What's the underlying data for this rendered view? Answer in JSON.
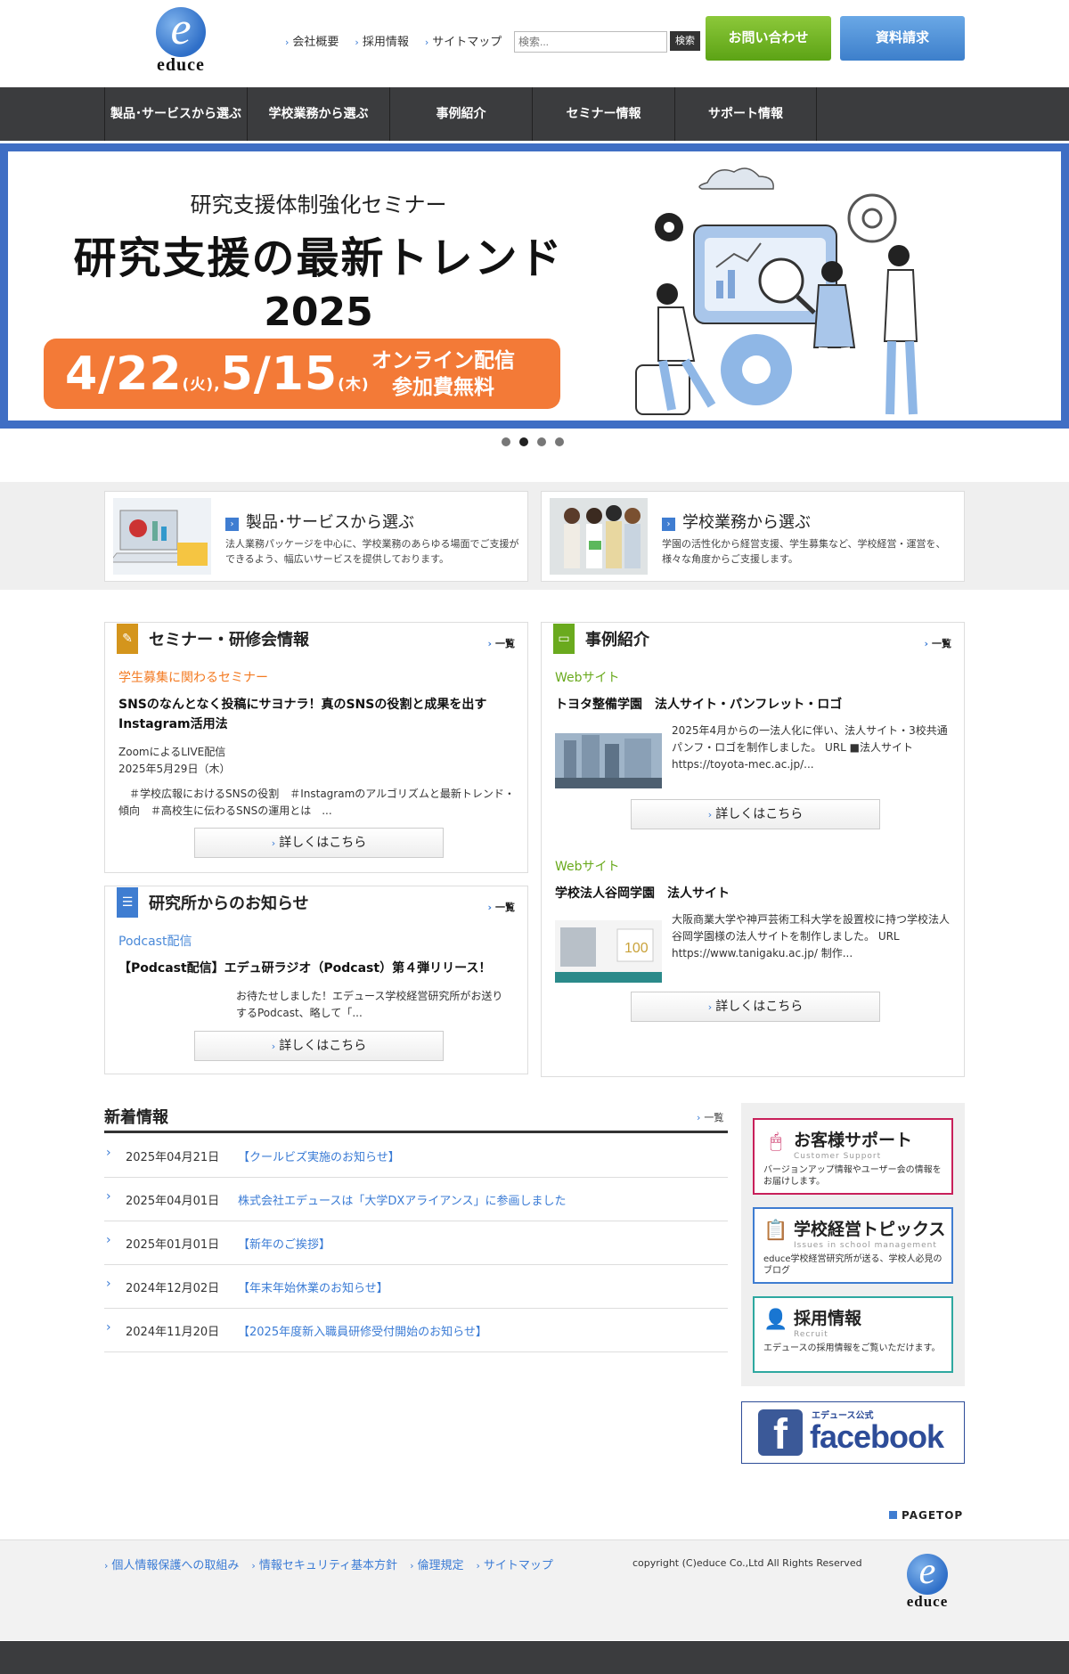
{
  "header": {
    "logo_text": "educe",
    "top_links": [
      "会社概要",
      "採用情報",
      "サイトマップ"
    ],
    "search_placeholder": "検索...",
    "search_button": "検索",
    "contact_button": "お問い合わせ",
    "document_button": "資料請求"
  },
  "nav": {
    "items": [
      "製品･サービスから選ぶ",
      "学校業務から選ぶ",
      "事例紹介",
      "セミナー情報",
      "サポート情報"
    ]
  },
  "hero": {
    "subtitle": "研究支援体制強化セミナー",
    "title": "研究支援の最新トレンド",
    "year": "2025",
    "date1": "4/22",
    "day1": "(火)",
    "date2": "5/15",
    "day2": "(木)",
    "online_line1": "オンライン配信",
    "online_line2": "参加費無料",
    "slide_count": 4,
    "active_slide": 2
  },
  "categories": [
    {
      "title": "製品･サービスから選ぶ",
      "desc": "法人業務パッケージを中心に、学校業務のあらゆる場面でご支援ができるよう、幅広いサービスを提供しております。"
    },
    {
      "title": "学校業務から選ぶ",
      "desc": "学園の活性化から経営支援、学生募集など、学校経営・運営を、様々な角度からご支援します。"
    }
  ],
  "seminar": {
    "title": "セミナー・研修会情報",
    "more": "一覧",
    "tag": "学生募集に関わるセミナー",
    "item_title": "SNSのなんとなく投稿にサヨナラ！真のSNSの役割と成果を出すInstagram活用法",
    "line1": "ZoomによるLIVE配信",
    "line2": "2025年5月29日（木）",
    "desc": "　＃学校広報におけるSNSの役割　＃Instagramのアルゴリズムと最新トレンド・傾向　＃高校生に伝わるSNSの運用とは　...",
    "button": "詳しくはこちら"
  },
  "lab": {
    "title": "研究所からのお知らせ",
    "more": "一覧",
    "tag": "Podcast配信",
    "item_title": "【Podcast配信】エデュ研ラジオ（Podcast）第４弾リリース！",
    "desc": "お待たせしました！エデュース学校経営研究所がお送りするPodcast、略して「...",
    "button": "詳しくはこちら"
  },
  "cases": {
    "title": "事例紹介",
    "more": "一覧",
    "items": [
      {
        "tag": "Webサイト",
        "title": "トヨタ整備学園　法人サイト・パンフレット・ロゴ",
        "desc": "2025年4月からの一法人化に伴い、法人サイト・3校共通パンフ・ロゴを制作しました。 URL ■法人サイト https://toyota-mec.ac.jp/...",
        "button": "詳しくはこちら"
      },
      {
        "tag": "Webサイト",
        "title": "学校法人谷岡学園　法人サイト",
        "desc": "大阪商業大学や神戸芸術工科大学を設置校に持つ学校法人谷岡学園様の法人サイトを制作しました。 URL https://www.tanigaku.ac.jp/ 制作...",
        "button": "詳しくはこちら"
      }
    ]
  },
  "news": {
    "title": "新着情報",
    "more": "一覧",
    "items": [
      {
        "date": "2025年04月21日",
        "text": "【クールビズ実施のお知らせ】"
      },
      {
        "date": "2025年04月01日",
        "text": "株式会社エデュースは「大学DXアライアンス」に参画しました"
      },
      {
        "date": "2025年01月01日",
        "text": "【新年のご挨拶】"
      },
      {
        "date": "2024年12月02日",
        "text": "【年末年始休業のお知らせ】"
      },
      {
        "date": "2024年11月20日",
        "text": "【2025年度新入職員研修受付開始のお知らせ】"
      }
    ]
  },
  "side": {
    "cards": [
      {
        "title": "お客様サポート",
        "sub": "Customer Support",
        "desc": "バージョンアップ情報やユーザー会の情報をお届けします。",
        "color": "#c8205a"
      },
      {
        "title": "学校経営トピックス",
        "sub": "Issues in school management",
        "desc": "educe学校経営研究所が送る、学校人必見のブログ",
        "color": "#3f7dd1"
      },
      {
        "title": "採用情報",
        "sub": "Recruit",
        "desc": "エデュースの採用情報をご覧いただけます。",
        "color": "#2ea8a0"
      }
    ],
    "facebook_small": "エデュース公式",
    "facebook_text": "facebook"
  },
  "footer": {
    "pagetop": "PAGETOP",
    "links": [
      "個人情報保護への取組み",
      "情報セキュリティ基本方針",
      "倫理規定",
      "サイトマップ"
    ],
    "copyright": "copyright (C)educe Co.,Ltd All Rights Reserved",
    "logo_text": "educe"
  }
}
